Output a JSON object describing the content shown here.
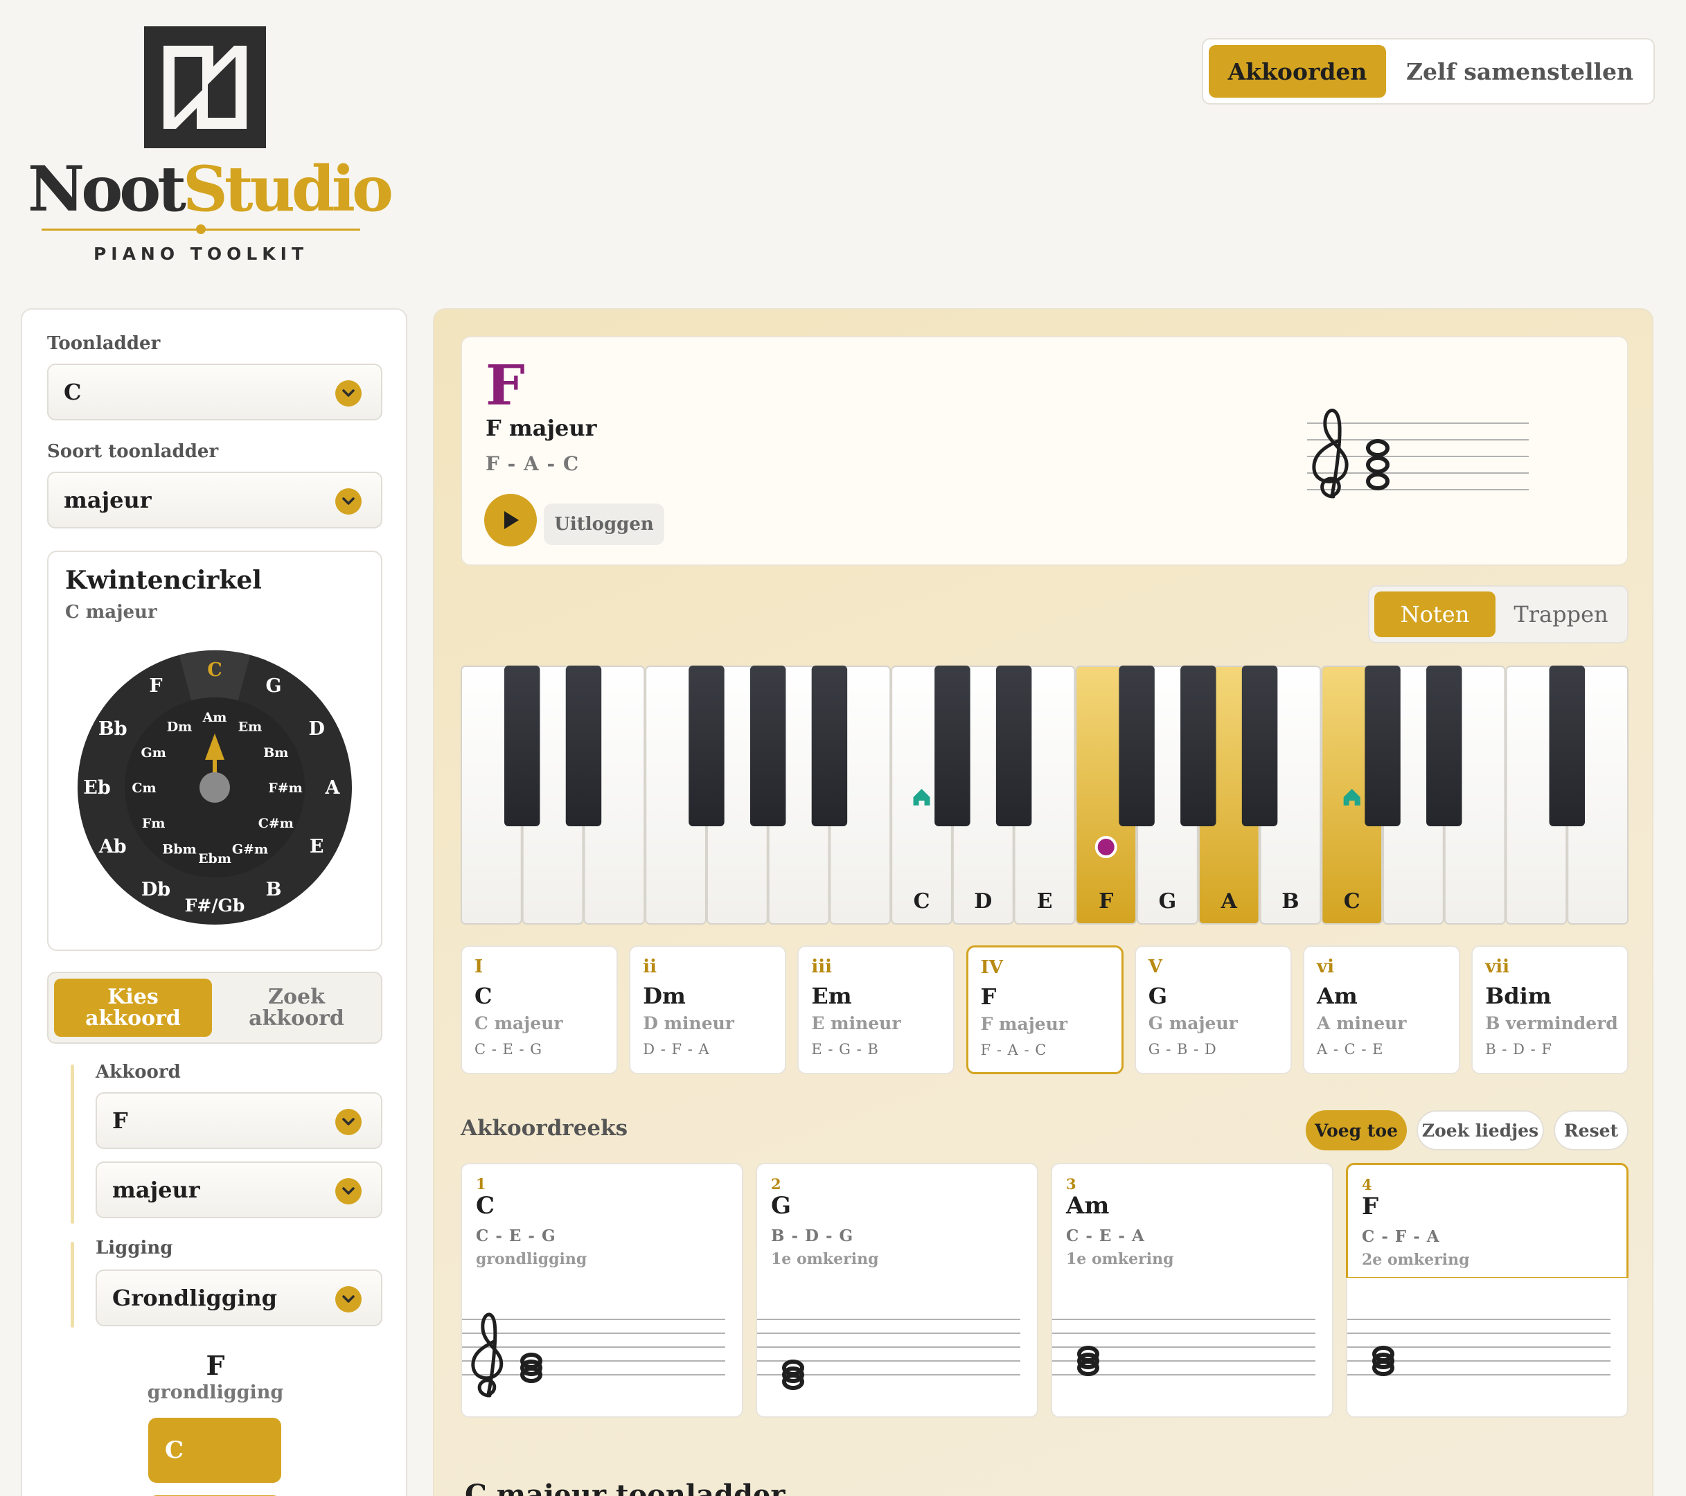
{
  "brand": {
    "name_part1": "Noot",
    "name_part2": "Studio",
    "tagline": "PIANO TOOLKIT"
  },
  "topnav": {
    "items": [
      "Akkoorden",
      "Zelf samenstellen"
    ],
    "active": 0
  },
  "sidebar": {
    "scale_label": "Toonladder",
    "scale_value": "C",
    "scale_type_label": "Soort toonladder",
    "scale_type_value": "majeur",
    "circle": {
      "title": "Kwintencirkel",
      "subtitle": "C majeur",
      "outer": [
        "C",
        "G",
        "D",
        "A",
        "E",
        "B",
        "F#/Gb",
        "Db",
        "Ab",
        "Eb",
        "Bb",
        "F"
      ],
      "inner": [
        "Am",
        "Em",
        "Bm",
        "F#m",
        "C#m",
        "G#m",
        "Ebm",
        "Bbm",
        "Fm",
        "Cm",
        "Gm",
        "Dm"
      ],
      "highlight": "C"
    },
    "pick_tabs": {
      "kies": [
        "Kies",
        "akkoord"
      ],
      "zoek": [
        "Zoek",
        "akkoord"
      ]
    },
    "chord_label": "Akkoord",
    "chord_root": "F",
    "chord_quality": "majeur",
    "position_label": "Ligging",
    "position_value": "Grondligging",
    "display_chord": "F",
    "display_position": "grondligging",
    "stack_top": "C"
  },
  "hero": {
    "letter": "F",
    "name": "F majeur",
    "notes": "F - A - C",
    "logout": "Uitloggen"
  },
  "mode": {
    "items": [
      "Noten",
      "Trappen"
    ],
    "active": 0
  },
  "piano": {
    "white_labels": [
      "",
      "",
      "",
      "",
      "",
      "",
      "",
      "C",
      "D",
      "E",
      "F",
      "G",
      "A",
      "B",
      "C",
      "",
      "",
      "",
      ""
    ],
    "highlighted": [
      10,
      12,
      14
    ],
    "home_markers": [
      7,
      14
    ],
    "root_dot": 10,
    "highlight_color": "#d4a421",
    "root_color": "#a1207f",
    "home_color": "#1fa68c"
  },
  "degrees": [
    {
      "roman": "I",
      "chord": "C",
      "quality": "C majeur",
      "notes": "C - E - G"
    },
    {
      "roman": "ii",
      "chord": "Dm",
      "quality": "D mineur",
      "notes": "D - F - A"
    },
    {
      "roman": "iii",
      "chord": "Em",
      "quality": "E mineur",
      "notes": "E - G - B"
    },
    {
      "roman": "IV",
      "chord": "F",
      "quality": "F majeur",
      "notes": "F - A - C"
    },
    {
      "roman": "V",
      "chord": "G",
      "quality": "G majeur",
      "notes": "G - B - D"
    },
    {
      "roman": "vi",
      "chord": "Am",
      "quality": "A mineur",
      "notes": "A - C - E"
    },
    {
      "roman": "vii",
      "chord": "Bdim",
      "quality": "B verminderd",
      "notes": "B - D - F"
    }
  ],
  "sequence": {
    "title": "Akkoordreeks",
    "buttons": {
      "add": "Voeg toe",
      "songs": "Zoek liedjes",
      "reset": "Reset"
    },
    "items": [
      {
        "num": "1",
        "chord": "C",
        "notes": "C - E - G",
        "inversion": "grondligging"
      },
      {
        "num": "2",
        "chord": "G",
        "notes": "B - D - G",
        "inversion": "1e omkering"
      },
      {
        "num": "3",
        "chord": "Am",
        "notes": "C - E - A",
        "inversion": "1e omkering"
      },
      {
        "num": "4",
        "chord": "F",
        "notes": "C - F - A",
        "inversion": "2e omkering"
      }
    ]
  },
  "scale_section_title": "C majeur toonladder",
  "colors": {
    "accent": "#d4a421",
    "accent_dark": "#b88a12",
    "root_purple": "#8a1f78"
  }
}
